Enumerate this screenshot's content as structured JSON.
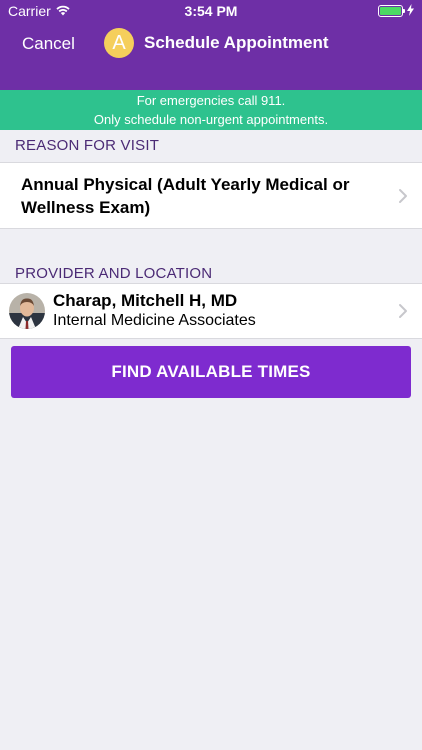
{
  "status_bar": {
    "carrier": "Carrier",
    "time": "3:54 PM",
    "battery_level": 1.0
  },
  "nav": {
    "cancel_label": "Cancel",
    "avatar_letter": "A",
    "title": "Schedule Appointment"
  },
  "banner": {
    "line1": "For emergencies call 911.",
    "line2": "Only schedule non-urgent appointments."
  },
  "reason": {
    "header": "REASON FOR VISIT",
    "value": "Annual Physical (Adult Yearly Medical or Wellness Exam)"
  },
  "provider": {
    "header": "PROVIDER AND LOCATION",
    "name": "Charap, Mitchell H, MD",
    "location": "Internal Medicine Associates"
  },
  "action": {
    "find_label": "FIND AVAILABLE TIMES"
  },
  "colors": {
    "nav_purple": "#6e2fa6",
    "banner_green": "#2ec28e",
    "button_purple": "#7e2bcf",
    "avatar_yellow": "#f5cf5c",
    "section_header_text": "#4b2a75"
  },
  "icons": {
    "wifi": "wifi-icon",
    "battery": "battery-icon",
    "charging": "charging-bolt-icon",
    "chevron": "chevron-right-icon",
    "provider_photo": "provider-photo"
  }
}
